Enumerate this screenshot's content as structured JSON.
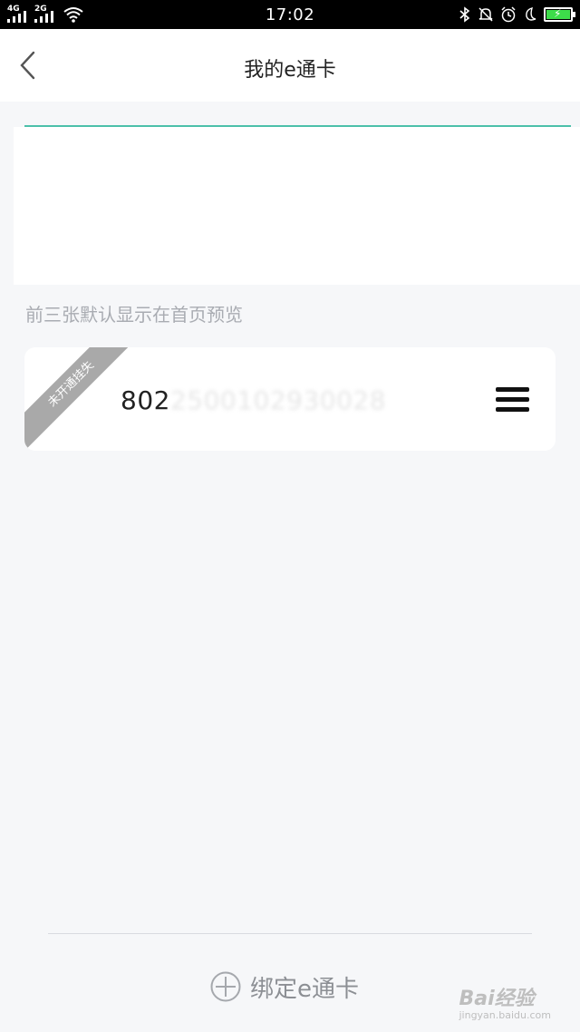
{
  "status_bar": {
    "time": "17:02",
    "network_1": "4G",
    "network_2": "2G",
    "icons": [
      "bluetooth-icon",
      "bell-muted-icon",
      "alarm-icon",
      "moon-icon",
      "battery-charging-icon"
    ]
  },
  "nav": {
    "title": "我的e通卡"
  },
  "preview": {
    "hint": "前三张默认显示在首页预览"
  },
  "card": {
    "ribbon": "未开通挂失",
    "number_visible": "802",
    "number_obscured": "2500102930028"
  },
  "bottom": {
    "bind_label": "绑定e通卡"
  },
  "watermark": {
    "main": "Bai经验",
    "sub": "jingyan.baidu.com"
  },
  "colors": {
    "accent": "#4cc0aa",
    "page_background": "#f6f7f9",
    "ribbon": "#a9a9a9"
  }
}
